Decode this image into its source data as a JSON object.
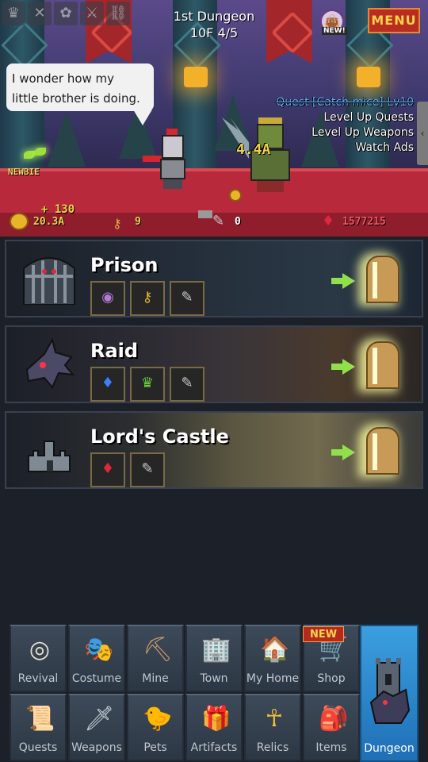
{
  "header": {
    "dungeon_name": "1st Dungeon",
    "floor_progress": "10F 4/5",
    "new_badge": "NEW!",
    "menu_label": "MENU",
    "top_icons": [
      "trophy-icon",
      "close-x-icon",
      "paw-icon",
      "sword-icon",
      "chain-icon"
    ]
  },
  "scene": {
    "speech": [
      "I wonder how my",
      "little brother is doing."
    ],
    "newbie_label": "NEWBIE",
    "enemy_hp": "4.4A",
    "quest_active": "Quest [Catch mice] Lv10",
    "quick_actions": [
      "Level Up Quests",
      "Level Up Weapons",
      "Watch Ads"
    ]
  },
  "resources": {
    "gold_gain": "+ 130",
    "gold": "20.3A",
    "keys": "9",
    "scrolls": "0",
    "rubies": "1577215"
  },
  "dungeons": [
    {
      "name": "Prison",
      "icon": "prison-gate-icon",
      "rewards": [
        "purple-token-icon",
        "key-icon",
        "scroll-icon"
      ]
    },
    {
      "name": "Raid",
      "icon": "dragon-icon",
      "rewards": [
        "blue-gem-icon",
        "green-crown-gem-icon",
        "scroll-icon"
      ]
    },
    {
      "name": "Lord's Castle",
      "icon": "castle-icon",
      "rewards": [
        "ruby-icon",
        "scroll-icon"
      ]
    }
  ],
  "nav": {
    "row1": [
      {
        "label": "Revival",
        "icon": "revival-rune-icon",
        "glyph": "◎"
      },
      {
        "label": "Costume",
        "icon": "mask-icon",
        "glyph": "🎭"
      },
      {
        "label": "Mine",
        "icon": "minecart-icon",
        "glyph": "⛏"
      },
      {
        "label": "Town",
        "icon": "building-icon",
        "glyph": "🏢"
      },
      {
        "label": "My Home",
        "icon": "house-icon",
        "glyph": "🏠"
      },
      {
        "label": "Shop",
        "icon": "shopkeeper-icon",
        "glyph": "🛒"
      }
    ],
    "row2": [
      {
        "label": "Quests",
        "icon": "quest-scroll-icon",
        "glyph": "📜"
      },
      {
        "label": "Weapons",
        "icon": "sword-icon",
        "glyph": "🗡"
      },
      {
        "label": "Pets",
        "icon": "chick-icon",
        "glyph": "🐤"
      },
      {
        "label": "Artifacts",
        "icon": "treasure-chest-icon",
        "glyph": "🎁"
      },
      {
        "label": "Relics",
        "icon": "ankh-icon",
        "glyph": "☥"
      },
      {
        "label": "Items",
        "icon": "backpack-icon",
        "glyph": "🎒"
      }
    ],
    "shop_new": "NEW",
    "dungeon_label": "Dungeon"
  }
}
